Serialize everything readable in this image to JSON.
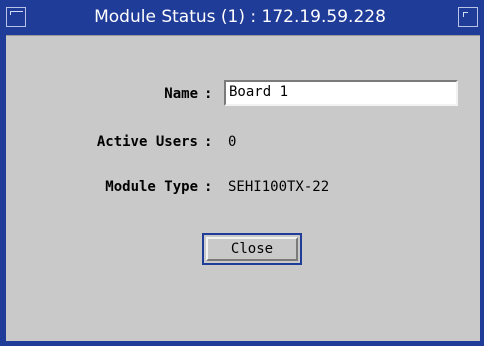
{
  "window": {
    "title": "Module Status (1) : 172.19.59.228",
    "menu_icon": "window-menu-icon",
    "corner_icon": "window-corner-icon",
    "title_bar_color": "#1f3c98",
    "panel_color": "#c9c9c9"
  },
  "fields": {
    "name_label": "Name",
    "name_value": "Board 1",
    "active_users_label": "Active Users",
    "active_users_value": "0",
    "module_type_label": "Module Type",
    "module_type_value": "SEHI100TX-22",
    "separator": ":"
  },
  "buttons": {
    "close_label": "Close"
  }
}
